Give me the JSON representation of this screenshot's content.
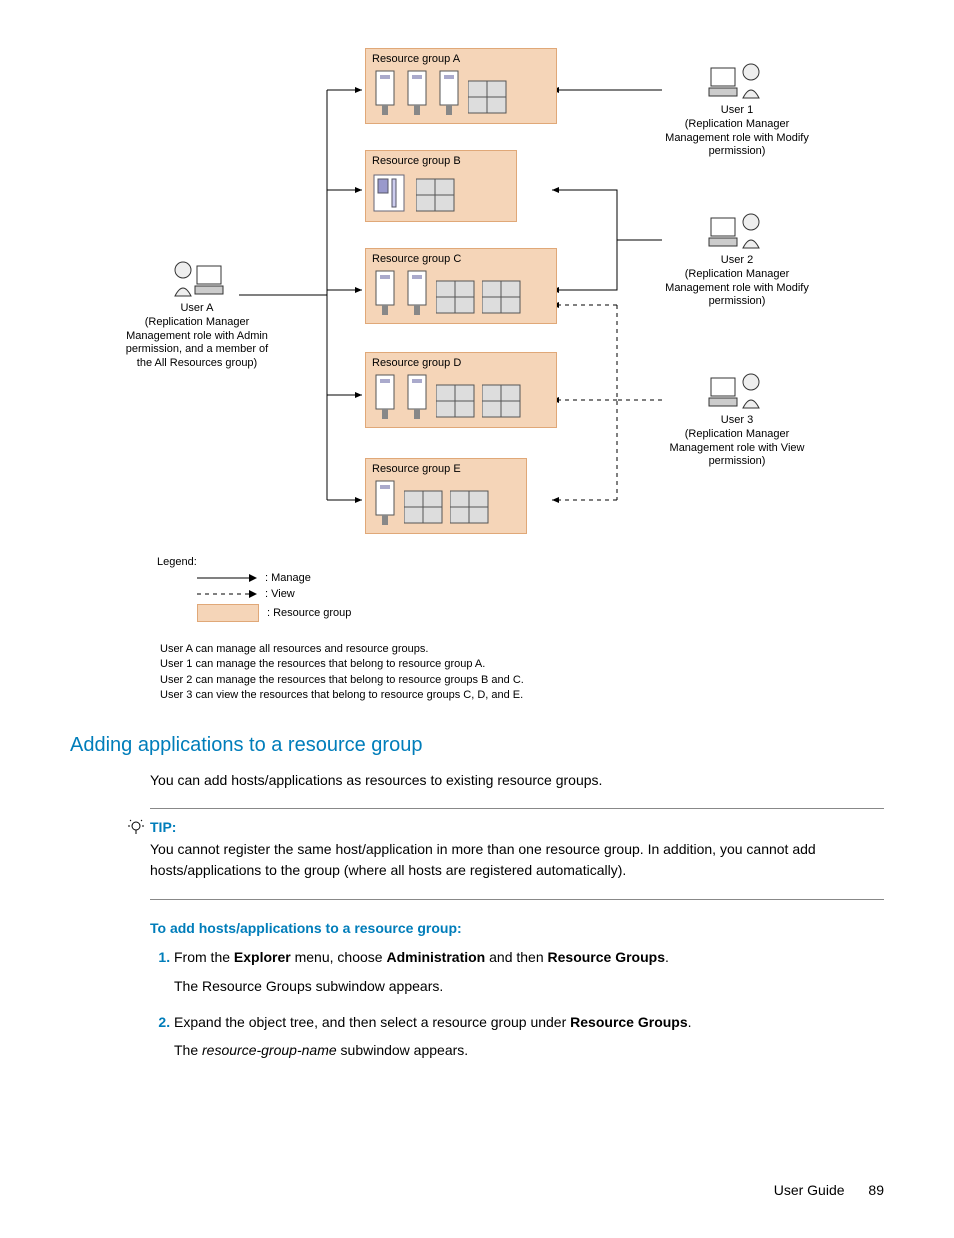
{
  "diagram": {
    "groups": {
      "A": "Resource group A",
      "B": "Resource group B",
      "C": "Resource group C",
      "D": "Resource group D",
      "E": "Resource group E"
    },
    "userA": {
      "name": "User A",
      "desc": "(Replication Manager Management role with Admin permission, and a member of the All Resources group)"
    },
    "user1": {
      "name": "User 1",
      "desc": "(Replication Manager Management role with Modify permission)"
    },
    "user2": {
      "name": "User 2",
      "desc": "(Replication Manager Management role with Modify permission)"
    },
    "user3": {
      "name": "User 3",
      "desc": "(Replication Manager Management role with View permission)"
    },
    "legend": {
      "title": "Legend:",
      "manage": ": Manage",
      "view": ": View",
      "rg": ": Resource group"
    }
  },
  "notes": {
    "l1": "User A can manage all resources and resource groups.",
    "l2": "User 1 can manage the resources that belong to resource group A.",
    "l3": "User 2 can manage the resources that belong to resource groups B and C.",
    "l4": "User 3 can view the resources that belong to resource groups C, D, and E."
  },
  "section": {
    "title": "Adding applications to a resource group",
    "intro": "You can add hosts/applications as resources to existing resource groups."
  },
  "tip": {
    "label": "TIP:",
    "text_a": "You cannot register the same host/application in more than one resource group. In addition, you cannot add hosts/applications to the ",
    "text_b": " group (where all hosts are registered automatically)."
  },
  "procedure": {
    "heading": "To add hosts/applications to a resource group:",
    "step1_a": "From the ",
    "step1_b": "Explorer",
    "step1_c": " menu, choose ",
    "step1_d": "Administration",
    "step1_e": " and then ",
    "step1_f": "Resource Groups",
    "step1_g": ".",
    "step1_sub": "The Resource Groups subwindow appears.",
    "step2_a": "Expand the object tree, and then select a resource group under ",
    "step2_b": "Resource Groups",
    "step2_c": ".",
    "step2_sub_a": "The ",
    "step2_sub_b": "resource-group-name",
    "step2_sub_c": " subwindow appears."
  },
  "footer": {
    "title": "User Guide",
    "page": "89"
  }
}
